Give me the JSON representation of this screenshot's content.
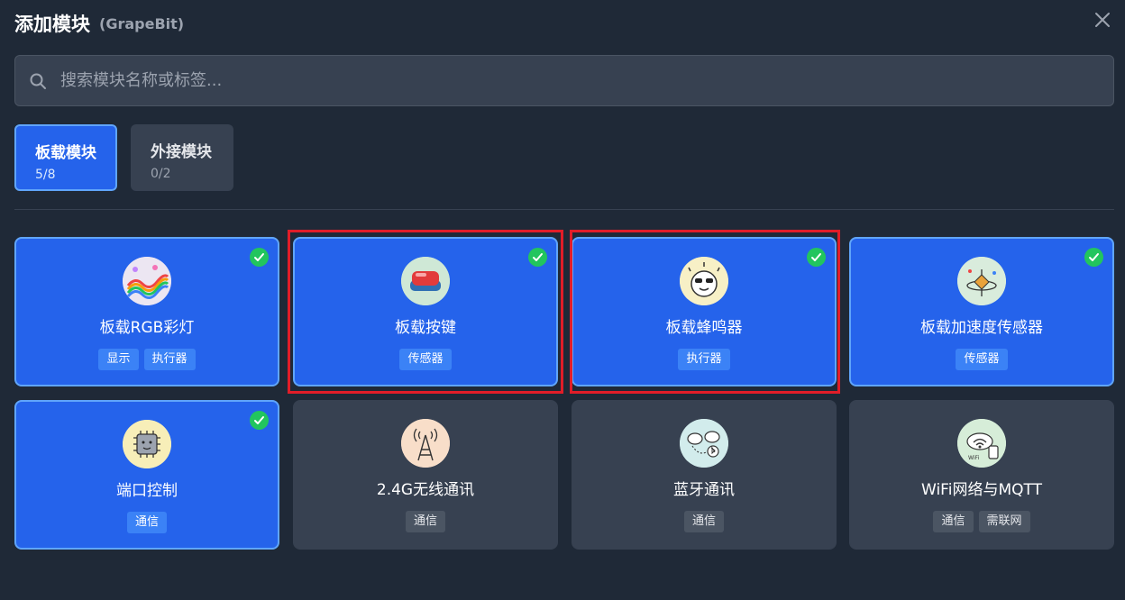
{
  "header": {
    "title": "添加模块",
    "subtitle": "(GrapeBit)"
  },
  "search": {
    "placeholder": "搜索模块名称或标签..."
  },
  "tabs": [
    {
      "label": "板载模块",
      "count": "5/8"
    },
    {
      "label": "外接模块",
      "count": "0/2"
    }
  ],
  "modules": [
    {
      "name": "板载RGB彩灯",
      "tags": [
        "显示",
        "执行器"
      ],
      "selected": true,
      "icon": "rgb-led-icon"
    },
    {
      "name": "板载按键",
      "tags": [
        "传感器"
      ],
      "selected": true,
      "icon": "button-icon"
    },
    {
      "name": "板载蜂鸣器",
      "tags": [
        "执行器"
      ],
      "selected": true,
      "icon": "buzzer-icon"
    },
    {
      "name": "板载加速度传感器",
      "tags": [
        "传感器"
      ],
      "selected": true,
      "icon": "accelerometer-icon"
    },
    {
      "name": "端口控制",
      "tags": [
        "通信"
      ],
      "selected": true,
      "icon": "port-chip-icon"
    },
    {
      "name": "2.4G无线通讯",
      "tags": [
        "通信"
      ],
      "selected": false,
      "icon": "radio-tower-icon"
    },
    {
      "name": "蓝牙通讯",
      "tags": [
        "通信"
      ],
      "selected": false,
      "icon": "bluetooth-cloud-icon"
    },
    {
      "name": "WiFi网络与MQTT",
      "tags": [
        "通信",
        "需联网"
      ],
      "selected": false,
      "icon": "wifi-cloud-icon"
    }
  ],
  "colors": {
    "background": "#1f2937",
    "selected_card": "#2563eb",
    "unselected_card": "#374151",
    "check": "#22c55e",
    "highlight": "#e11d28"
  }
}
